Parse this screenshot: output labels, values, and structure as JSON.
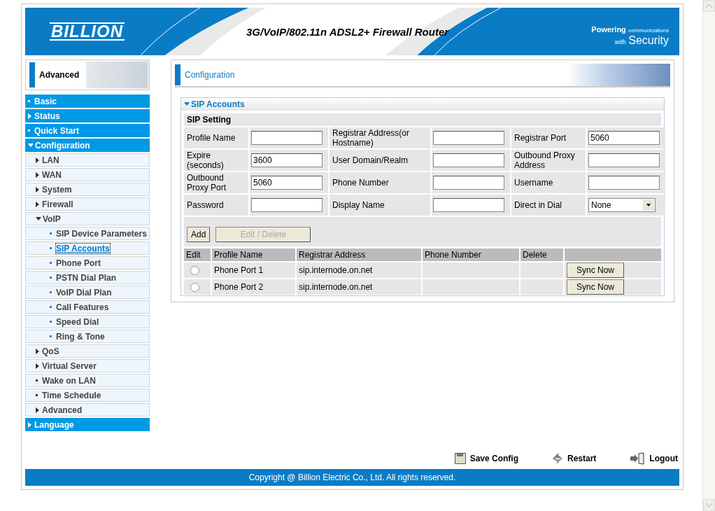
{
  "header": {
    "logo": "BILLION",
    "title": "3G/VoIP/802.11n ADSL2+ Firewall Router",
    "tagline_top": "Powering",
    "tagline_small": "communications",
    "tagline_with": "with",
    "tagline_big": "Security"
  },
  "sidebar": {
    "mode_label": "Advanced",
    "items": [
      {
        "label": "Basic",
        "kind": "dot",
        "expanded": false
      },
      {
        "label": "Status",
        "kind": "arrow",
        "expanded": false
      },
      {
        "label": "Quick Start",
        "kind": "dot",
        "expanded": false
      },
      {
        "label": "Configuration",
        "kind": "arrow",
        "expanded": true,
        "children": [
          {
            "label": "LAN",
            "kind": "arrow",
            "expanded": false
          },
          {
            "label": "WAN",
            "kind": "arrow",
            "expanded": false
          },
          {
            "label": "System",
            "kind": "arrow",
            "expanded": false
          },
          {
            "label": "Firewall",
            "kind": "arrow",
            "expanded": false
          },
          {
            "label": "VoIP",
            "kind": "arrow",
            "expanded": true,
            "children": [
              {
                "label": "SIP Device Parameters",
                "selected": false
              },
              {
                "label": "SIP Accounts",
                "selected": true
              },
              {
                "label": "Phone Port",
                "selected": false
              },
              {
                "label": "PSTN Dial Plan",
                "selected": false
              },
              {
                "label": "VoIP Dial Plan",
                "selected": false
              },
              {
                "label": "Call Features",
                "selected": false
              },
              {
                "label": "Speed Dial",
                "selected": false
              },
              {
                "label": "Ring & Tone",
                "selected": false
              }
            ]
          },
          {
            "label": "QoS",
            "kind": "arrow",
            "expanded": false
          },
          {
            "label": "Virtual Server",
            "kind": "arrow",
            "expanded": false
          },
          {
            "label": "Wake on LAN",
            "kind": "dot",
            "expanded": false
          },
          {
            "label": "Time Schedule",
            "kind": "dot",
            "expanded": false
          },
          {
            "label": "Advanced",
            "kind": "arrow",
            "expanded": false
          }
        ]
      },
      {
        "label": "Language",
        "kind": "arrow",
        "expanded": false
      }
    ]
  },
  "main": {
    "title": "Configuration",
    "section": {
      "title": "SIP Accounts",
      "expanded": true,
      "subtitle": "SIP Setting",
      "fields": [
        {
          "label": "Profile Name",
          "kind": "text"
        },
        {
          "label": "Registrar Address(or Hostname)",
          "kind": "text"
        },
        {
          "label": "Registrar Port",
          "value": "5060",
          "kind": "text"
        },
        {
          "label": "Expire (seconds)",
          "value": "3600",
          "kind": "text"
        },
        {
          "label": "User Domain/Realm",
          "kind": "text"
        },
        {
          "label": "Outbound Proxy Address",
          "kind": "text"
        },
        {
          "label": "Outbound Proxy Port",
          "value": "5060",
          "kind": "text"
        },
        {
          "label": "Phone Number",
          "kind": "text"
        },
        {
          "label": "Username",
          "kind": "text"
        },
        {
          "label": "Password",
          "kind": "text"
        },
        {
          "label": "Display Name",
          "kind": "text"
        },
        {
          "label": "Direct in Dial",
          "value": "None",
          "kind": "select"
        }
      ],
      "buttons": [
        {
          "label": "Add",
          "disabled": false
        },
        {
          "label": "Edit / Delete",
          "disabled": true
        }
      ],
      "table": {
        "columns": [
          "Edit",
          "Profile Name",
          "Registrar Address",
          "Phone Number",
          "Delete"
        ],
        "rows": [
          {
            "selected": false,
            "profile_name": "Phone Port 1",
            "registrar_address": "sip.internode.on.net",
            "action": "Sync Now"
          },
          {
            "selected": false,
            "profile_name": "Phone Port 2",
            "registrar_address": "sip.internode.on.net",
            "action": "Sync Now"
          }
        ]
      }
    }
  },
  "footer": {
    "links": [
      {
        "label": "Save Config",
        "kind": "save"
      },
      {
        "label": "Restart",
        "kind": "restart"
      },
      {
        "label": "Logout",
        "kind": "logout"
      }
    ],
    "copyright": "Copyright @ Billion Electric Co., Ltd. All rights reserved."
  }
}
